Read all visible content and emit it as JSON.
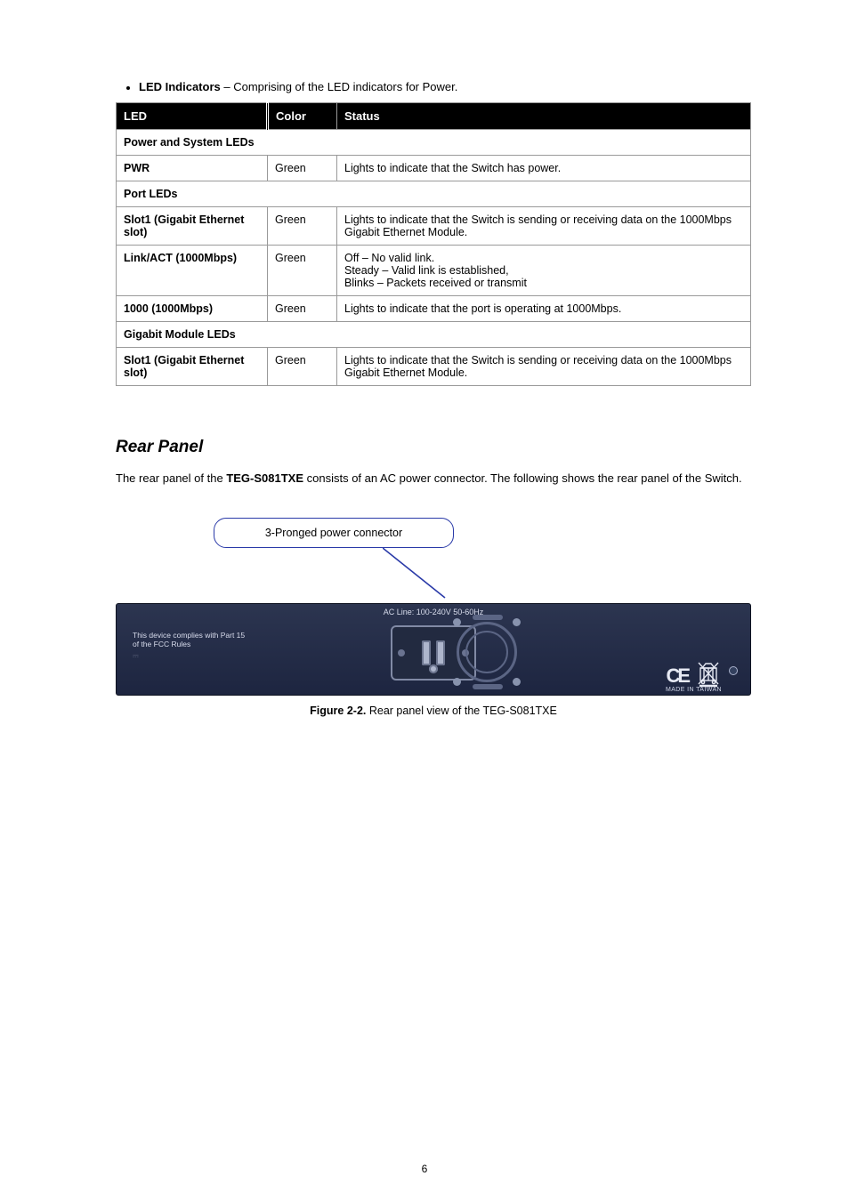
{
  "top_bullet": {
    "prefix": "LED Indicators",
    "rest": " – Comprising of the LED indicators for Power."
  },
  "table": {
    "headers": [
      "LED",
      "Color",
      "Status"
    ],
    "sections": [
      {
        "title": "Power and System LEDs",
        "rows": [
          {
            "led": "PWR",
            "color": "Green",
            "status": "Lights to indicate that the Switch has power."
          }
        ]
      },
      {
        "title": "Port LEDs",
        "rows": [
          {
            "led": "Slot1 (Gigabit Ethernet slot)",
            "color": "Green",
            "status": "Lights to indicate that the Switch is sending or receiving data on the 1000Mbps Gigabit Ethernet Module."
          },
          {
            "led": "Link/ACT (1000Mbps)",
            "color": "Green",
            "status": "Off – No valid link.\nSteady – Valid link is established,\nBlinks – Packets received or transmit"
          },
          {
            "led": "1000 (1000Mbps)",
            "color": "Green",
            "status": "Lights to indicate that the port is operating at 1000Mbps."
          }
        ]
      },
      {
        "title": "Gigabit Module LEDs",
        "rows": [
          {
            "led": "Slot1 (Gigabit Ethernet slot)",
            "color": "Green",
            "status": "Lights to indicate that the Switch is sending or receiving data on the 1000Mbps Gigabit Ethernet Module."
          }
        ]
      }
    ]
  },
  "rear": {
    "title": "Rear Panel",
    "desc_1": "The rear panel of the ",
    "desc_model": "TEG-S081TXE",
    "desc_2": " consists of an AC power connector. The following shows the rear panel of the Switch.",
    "callout": "3-Pronged power connector",
    "acline": "AC Line: 100-240V 50-60Hz",
    "fcc_line1": "This device complies with Part 15",
    "fcc_line2": "of the FCC Rules",
    "mit": "MADE IN TAIWAN",
    "figcap_prefix": "Figure 2-2.",
    "figcap_rest": " Rear panel view of the TEG-S081TXE"
  },
  "page_number": "6"
}
